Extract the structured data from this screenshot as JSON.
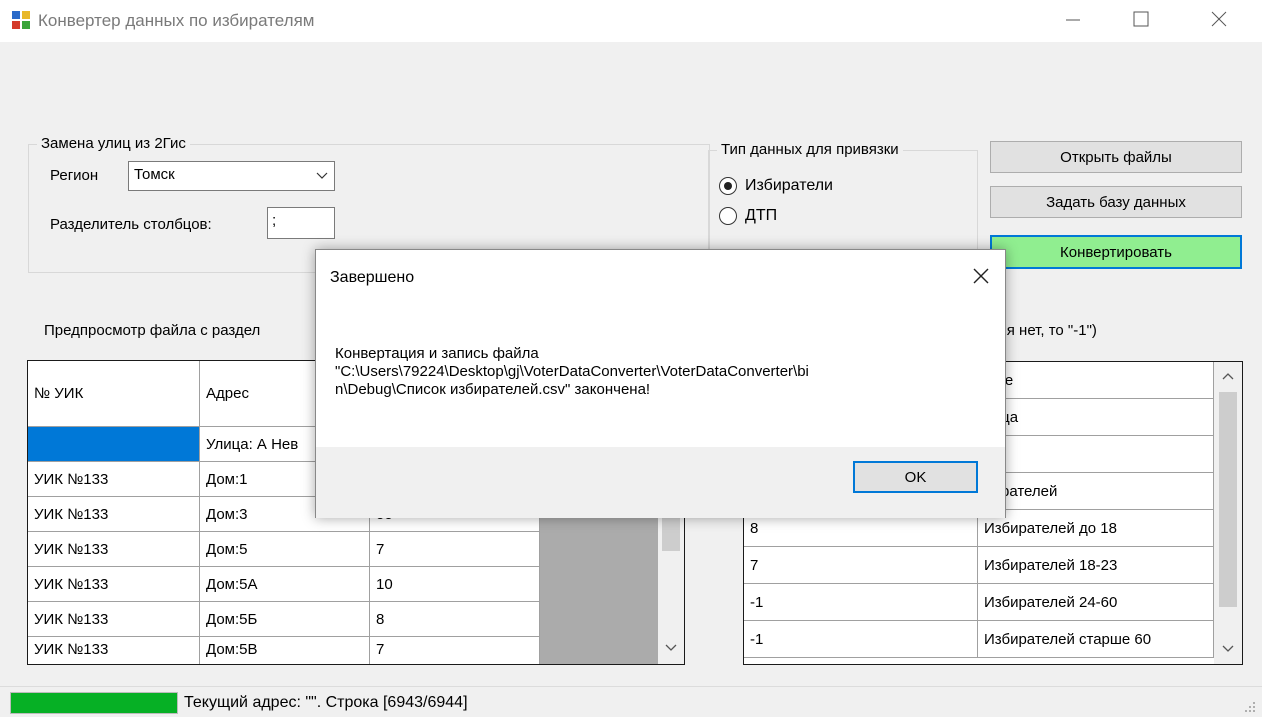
{
  "window": {
    "title": "Конвертер данных по избирателям"
  },
  "streets_group": {
    "legend": "Замена улиц из 2Гис",
    "region_label": "Регион",
    "region_value": "Томск",
    "separator_label": "Разделитель столбцов:",
    "separator_value": ";"
  },
  "binding_group": {
    "legend": "Тип данных для привязки",
    "options": [
      {
        "label": "Избиратели",
        "checked": true
      },
      {
        "label": "ДТП",
        "checked": false
      }
    ]
  },
  "buttons": {
    "open_files": "Открыть файлы",
    "set_database": "Задать базу данных",
    "convert": "Конвертировать"
  },
  "preview_label": "Предпросмотр файла с раздел",
  "mapping_hint": "оля нет, то \"-1\")",
  "preview_table": {
    "headers": [
      "№ УИК",
      "Адрес"
    ],
    "rows": [
      [
        "",
        "Улица: А Нев",
        ""
      ],
      [
        "УИК №133",
        "Дом:1",
        ""
      ],
      [
        "УИК №133",
        "Дом:3",
        "oo"
      ],
      [
        "УИК №133",
        "Дом:5",
        "7"
      ],
      [
        "УИК №133",
        "Дом:5А",
        "10"
      ],
      [
        "УИК №133",
        "Дом:5Б",
        "8"
      ],
      [
        "УИК №133",
        "Дом:5В",
        "7"
      ]
    ]
  },
  "mapping_table": {
    "rows": [
      [
        "",
        "ame"
      ],
      [
        "",
        "лица"
      ],
      [
        "",
        "ом"
      ],
      [
        "",
        "бирателей"
      ],
      [
        "8",
        "Избирателей до 18"
      ],
      [
        "7",
        "Избирателей 18-23"
      ],
      [
        "-1",
        "Избирателей 24-60"
      ],
      [
        "-1",
        "Избирателей старше 60"
      ]
    ]
  },
  "status": {
    "progress": 0.9999,
    "text": "Текущий адрес: \"\". Строка [6943/6944]"
  },
  "dialog": {
    "title": "Завершено",
    "message": "Конвертация и запись файла\n\"C:\\Users\\79224\\Desktop\\gj\\VoterDataConverter\\VoterDataConverter\\bi\nn\\Debug\\Список избирателей.csv\" закончена!",
    "ok_label": "OK"
  },
  "colors": {
    "accent": "#0078d7",
    "convert_button": "#90ee90",
    "progress_fill": "#06b025"
  }
}
